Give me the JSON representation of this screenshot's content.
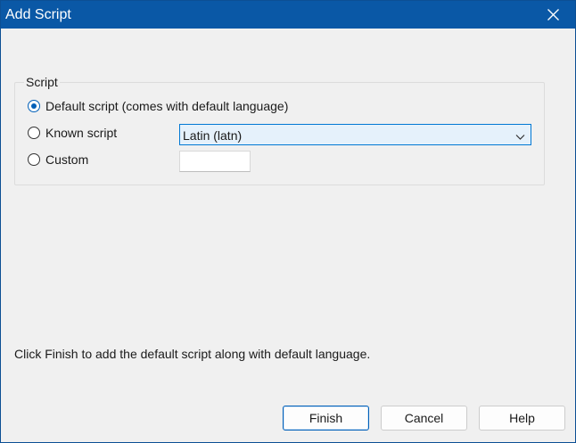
{
  "window": {
    "title": "Add Script"
  },
  "script_group": {
    "legend": "Script",
    "options": [
      {
        "label": "Default script (comes with default language)",
        "checked": true
      },
      {
        "label": "Known script",
        "checked": false
      },
      {
        "label": "Custom",
        "checked": false
      }
    ],
    "known_script_select": {
      "selected": "Latin (latn)"
    },
    "custom_input": {
      "value": ""
    }
  },
  "info": {
    "message": "Click Finish to add the default script along with default language."
  },
  "buttons": {
    "finish": "Finish",
    "cancel": "Cancel",
    "help": "Help"
  },
  "icons": {
    "close": "close-icon",
    "dropdown": "chevron-down-icon"
  },
  "colors": {
    "title_bar": "#0a58a6",
    "accent": "#005fb8",
    "dialog_background": "#f0f0f0"
  }
}
